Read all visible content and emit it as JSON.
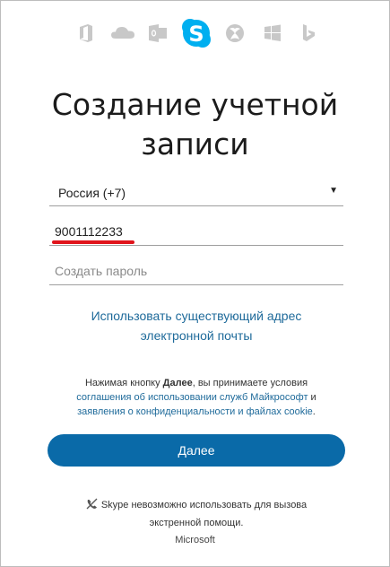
{
  "app_icons": [
    {
      "name": "office-icon"
    },
    {
      "name": "onedrive-icon"
    },
    {
      "name": "outlook-icon"
    },
    {
      "name": "skype-icon",
      "active": true
    },
    {
      "name": "xbox-icon"
    },
    {
      "name": "windows-icon"
    },
    {
      "name": "bing-icon"
    }
  ],
  "colors": {
    "skype_blue": "#00aff0",
    "icon_gray": "#c8c8c8",
    "link": "#1e6a9a",
    "button": "#0a6aa8",
    "underline": "#e0141b"
  },
  "form": {
    "title_line1": "Создание учетной",
    "title_line2": "записи",
    "country_value": "Россия (+7)",
    "phone_value": "9001112233",
    "password_placeholder": "Создать пароль",
    "use_email_line1": "Использовать существующий адрес",
    "use_email_line2": "электронной почты",
    "terms_prefix": "Нажимая кнопку ",
    "terms_bold": "Далее",
    "terms_mid": ", вы принимаете условия",
    "terms_link1": "соглашения об использовании служб Майкрософт",
    "terms_and": " и",
    "terms_link2": "заявления о конфиденциальности и файлах cookie",
    "terms_end": ".",
    "next_label": "Далее",
    "emergency_line1": "Skype невозможно использовать для вызова",
    "emergency_line2": "экстренной помощи."
  },
  "footer": {
    "brand": "Microsoft"
  }
}
